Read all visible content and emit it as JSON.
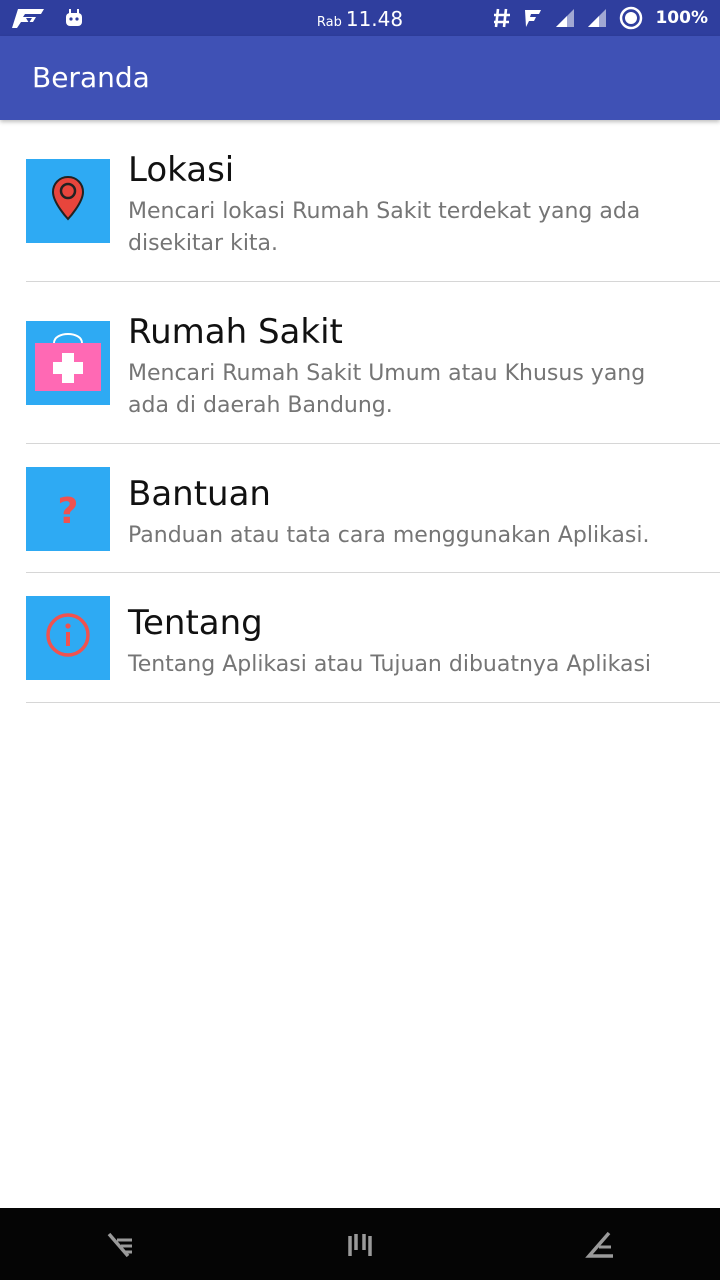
{
  "status_bar": {
    "day": "Rab",
    "time": "11.48",
    "battery": "100%",
    "icons": [
      "app-f-icon",
      "android-icon",
      "hash-icon",
      "signal-icon",
      "signal-icon",
      "signal-icon",
      "circle-icon"
    ]
  },
  "app_bar": {
    "title": "Beranda"
  },
  "menu": [
    {
      "title": "Lokasi",
      "description": "Mencari lokasi Rumah Sakit terdekat yang ada disekitar kita.",
      "icon": "location-pin-icon"
    },
    {
      "title": "Rumah Sakit",
      "description": "Mencari Rumah Sakit Umum atau Khusus yang ada di daerah Bandung.",
      "icon": "medical-kit-icon"
    },
    {
      "title": "Bantuan",
      "description": "Panduan atau tata cara menggunakan Aplikasi.",
      "icon": "question-mark-icon"
    },
    {
      "title": "Tentang",
      "description": "Tentang Aplikasi atau Tujuan dibuatnya Aplikasi",
      "icon": "info-icon"
    }
  ],
  "colors": {
    "status_bar": "#2f3e9e",
    "app_bar": "#3f51b5",
    "tile": "#2eaaf3",
    "icon_red": "#f0524f",
    "kit_pink": "#ff69b4"
  }
}
